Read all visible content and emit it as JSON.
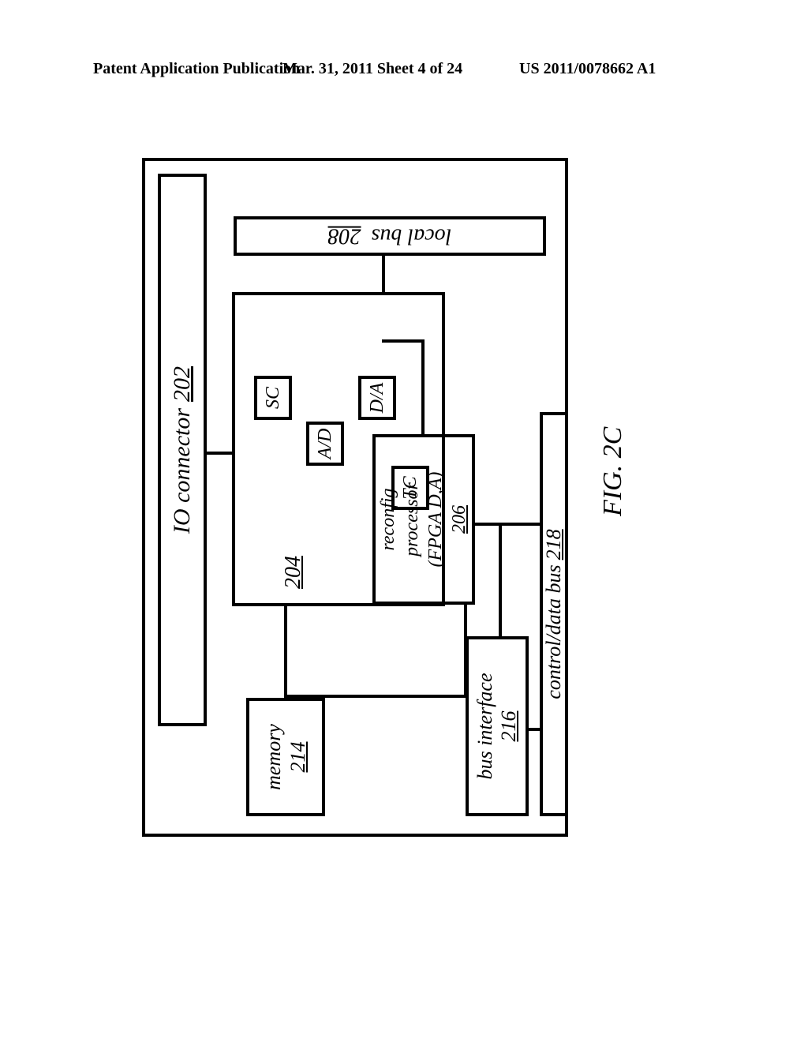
{
  "header": {
    "left": "Patent Application Publication",
    "center": "Mar. 31, 2011  Sheet 4 of 24",
    "right": "US 2011/0078662 A1"
  },
  "diagram": {
    "io_connector": {
      "label": "IO connector",
      "ref": "202"
    },
    "block204": {
      "ref": "204",
      "sc": "SC",
      "ad": "A/D",
      "da": "D/A",
      "tc": "TC"
    },
    "local_bus": {
      "label": "local bus",
      "ref": "208"
    },
    "reconfig": {
      "line1": "reconfig",
      "line2": "processor",
      "line3": "(FPGA D,A)",
      "ref": "206"
    },
    "memory": {
      "label": "memory",
      "ref": "214"
    },
    "bus_interface": {
      "label": "bus interface",
      "ref": "216"
    },
    "control_data_bus": {
      "label": "control/data bus",
      "ref": "218"
    }
  },
  "figure_label": "FIG. 2C"
}
